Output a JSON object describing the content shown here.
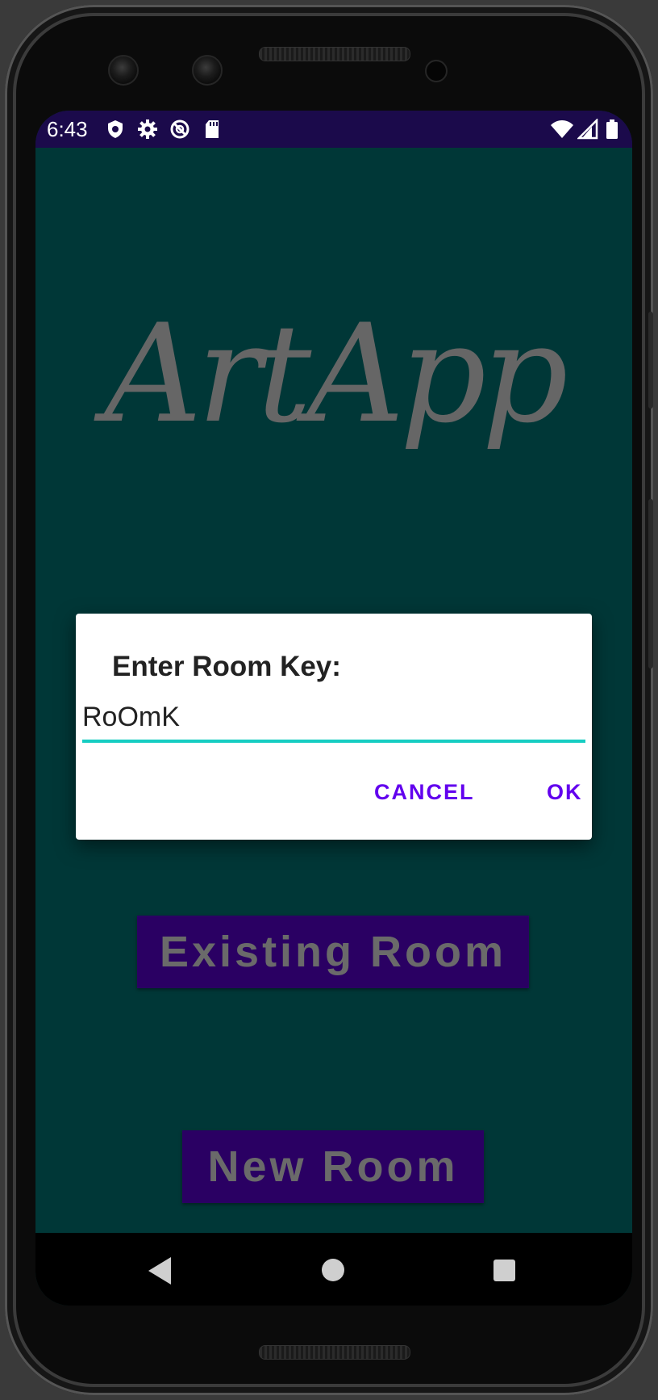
{
  "status_bar": {
    "time": "6:43",
    "left_icons": [
      "shield-icon",
      "gear-icon",
      "data-saver-icon",
      "sd-card-icon"
    ],
    "right_icons": [
      "wifi-icon",
      "signal-icon",
      "battery-icon"
    ]
  },
  "app": {
    "logo_text": "ArtApp",
    "existing_room_label": "Existing Room",
    "new_room_label": "New Room",
    "background_color": "#003737",
    "button_color": "#2a0063"
  },
  "dialog": {
    "title": "Enter Room Key:",
    "input_value": "RoOmK",
    "cancel_label": "CANCEL",
    "ok_label": "OK",
    "accent_color": "#6200ee",
    "underline_color": "#16cdc2"
  },
  "nav_bar": {
    "icons": [
      "back-icon",
      "home-icon",
      "recents-icon"
    ]
  }
}
